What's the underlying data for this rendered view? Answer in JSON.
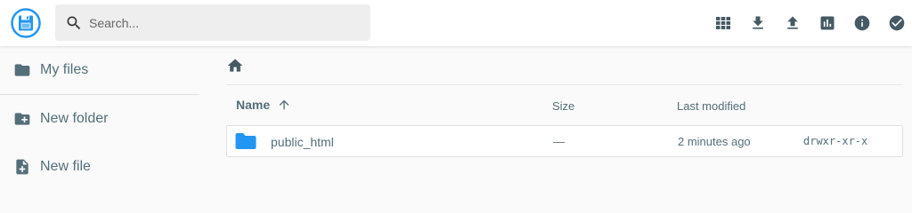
{
  "app": {
    "logo_icon": "floppy-disk-icon",
    "accent": "#2196f3"
  },
  "search": {
    "placeholder": "Search..."
  },
  "toolbar": {
    "buttons": [
      {
        "icon": "grid-view-icon"
      },
      {
        "icon": "download-icon"
      },
      {
        "icon": "upload-icon"
      },
      {
        "icon": "usage-chart-icon"
      },
      {
        "icon": "info-icon"
      },
      {
        "icon": "check-circle-icon"
      }
    ]
  },
  "sidebar": {
    "items": [
      {
        "label": "My files",
        "icon": "folder-icon"
      },
      {
        "label": "New folder",
        "icon": "create-folder-icon"
      },
      {
        "label": "New file",
        "icon": "note-add-icon"
      }
    ]
  },
  "breadcrumb": {
    "icon": "home-icon"
  },
  "listing": {
    "columns": {
      "name": "Name",
      "size": "Size",
      "modified": "Last modified"
    },
    "sort_icon": "arrow-up-icon",
    "rows": [
      {
        "name": "public_html",
        "size": "—",
        "modified": "2 minutes ago",
        "permissions": "drwxr-xr-x",
        "icon": "folder-icon",
        "icon_color": "#2196f3"
      }
    ]
  }
}
